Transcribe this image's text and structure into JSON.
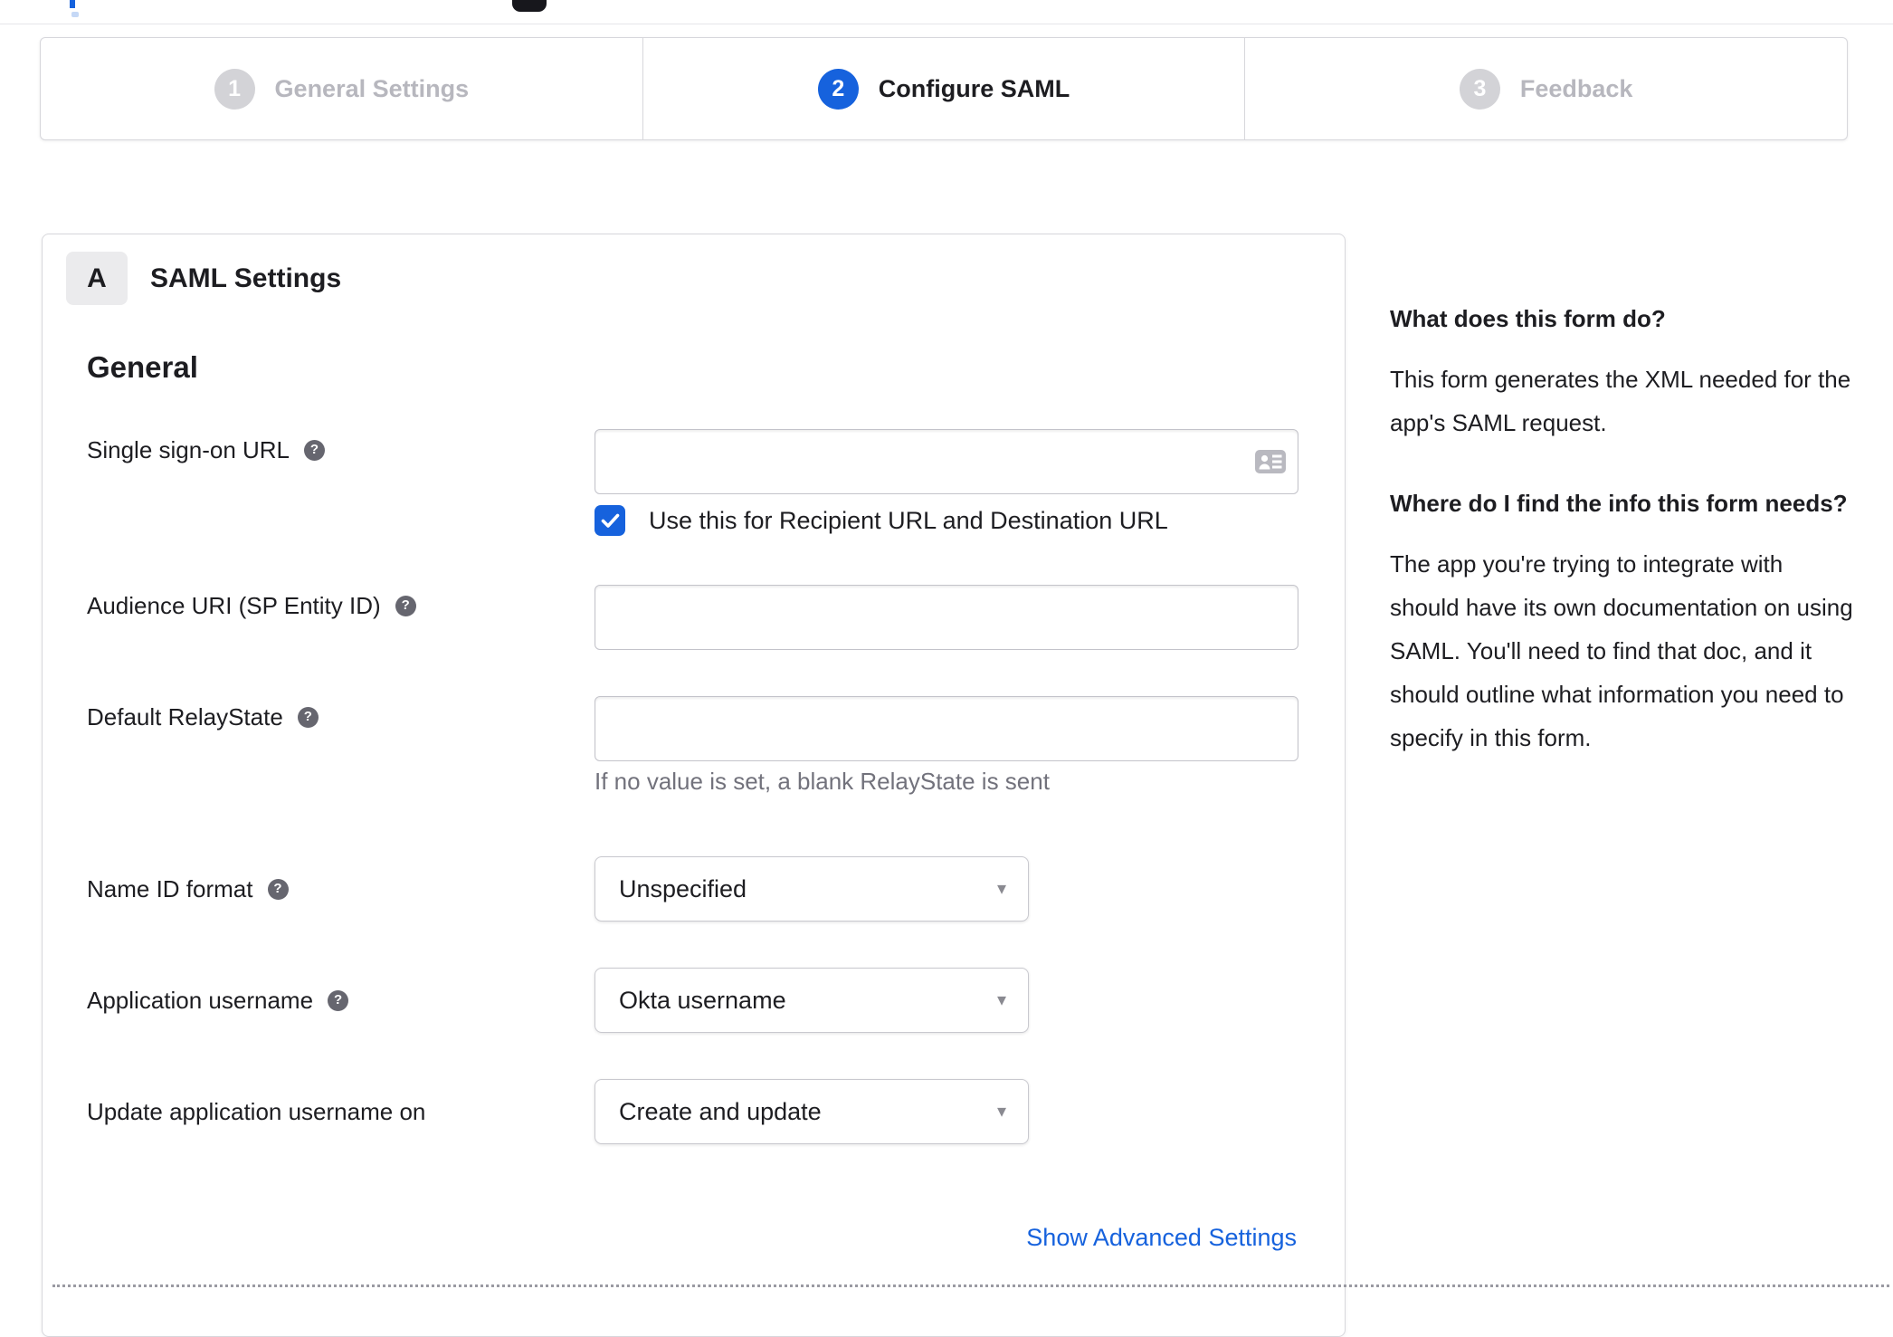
{
  "colors": {
    "accent_blue": "#1662dd",
    "text_dark": "#1d1d21",
    "text_gray": "#72727c",
    "inactive_gray": "#b7b7be",
    "border_light": "#d7d7dc"
  },
  "stepper": {
    "steps": [
      {
        "number": "1",
        "label": "General Settings",
        "state": "inactive"
      },
      {
        "number": "2",
        "label": "Configure SAML",
        "state": "active"
      },
      {
        "number": "3",
        "label": "Feedback",
        "state": "inactive"
      }
    ]
  },
  "panel": {
    "badge": "A",
    "title": "SAML Settings",
    "section": "General",
    "fields": {
      "sso": {
        "label": "Single sign-on URL",
        "value": "",
        "checkbox_label": "Use this for Recipient URL and Destination URL",
        "checkbox_checked": true
      },
      "audience": {
        "label": "Audience URI (SP Entity ID)",
        "value": ""
      },
      "relay": {
        "label": "Default RelayState",
        "value": "",
        "hint": "If no value is set, a blank RelayState is sent"
      },
      "nameid": {
        "label": "Name ID format",
        "value": "Unspecified"
      },
      "appuser": {
        "label": "Application username",
        "value": "Okta username"
      },
      "update": {
        "label": "Update application username on",
        "value": "Create and update"
      }
    },
    "advanced_link": "Show Advanced Settings"
  },
  "help_panel": {
    "sections": [
      {
        "heading": "What does this form do?",
        "body": "This form generates the XML needed for the app's SAML request."
      },
      {
        "heading": "Where do I find the info this form needs?",
        "body": "The app you're trying to integrate with should have its own documentation on using SAML. You'll need to find that doc, and it should outline what information you need to specify in this form."
      }
    ]
  },
  "icons": {
    "help_glyph": "?",
    "caret_glyph": "▾"
  }
}
